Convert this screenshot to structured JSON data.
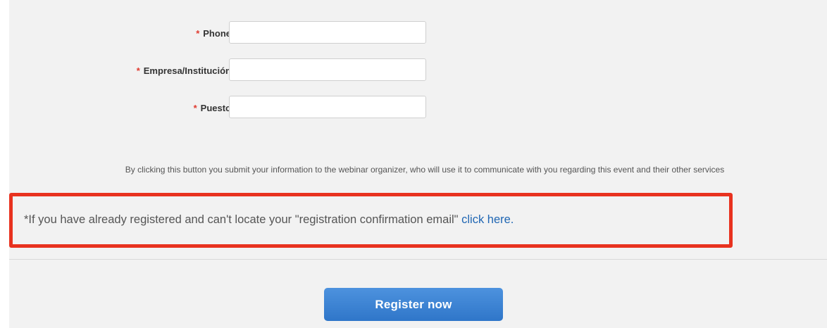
{
  "form": {
    "required_marker": "*",
    "fields": [
      {
        "label": "Phone",
        "value": "",
        "placeholder": ""
      },
      {
        "label": "Empresa/Institución",
        "value": "",
        "placeholder": ""
      },
      {
        "label": "Puesto",
        "value": "",
        "placeholder": ""
      }
    ]
  },
  "consent": {
    "text": "By clicking this button you submit your information to the webinar organizer, who will use it to communicate with you regarding this event and their other services"
  },
  "already_registered": {
    "text": "*If you have already registered and can't locate your \"registration confirmation email\" ",
    "link_label": "click here."
  },
  "register_button": {
    "label": "Register now"
  },
  "colors": {
    "required_marker": "#e03a2f",
    "highlight_border": "#e8321f",
    "link": "#1f66b3",
    "button": "#3a82d3",
    "panel_background": "#f2f2f2"
  }
}
